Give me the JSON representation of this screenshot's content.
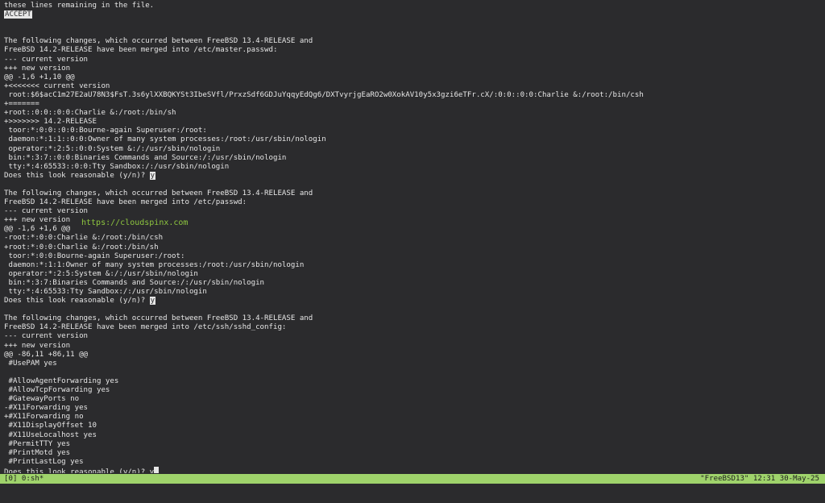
{
  "colors": {
    "background": "#2b2b2d",
    "foreground": "#e6e6e6",
    "statusbar": "#9fd36b",
    "watermark": "#8ec63f"
  },
  "terminal": {
    "lines": [
      {
        "text": "these lines remaining in the file."
      },
      {
        "text": "",
        "highlight": "ACCEPT"
      },
      {
        "text": ""
      },
      {
        "text": ""
      },
      {
        "text": "The following changes, which occurred between FreeBSD 13.4-RELEASE and"
      },
      {
        "text": "FreeBSD 14.2-RELEASE have been merged into /etc/master.passwd:"
      },
      {
        "text": "--- current version"
      },
      {
        "text": "+++ new version"
      },
      {
        "text": "@@ -1,6 +1,10 @@"
      },
      {
        "text": "+<<<<<<< current version"
      },
      {
        "text": " root:$6$acC1m27E2aU78N3$FsT.3s6ylXXBQKYSt3IbeSVfl/PrxzSdf6GDJuYqqyEdQg6/DXTvyrjgEaRO2w0XokAV10y5x3gzi6eTFr.cX/:0:0::0:0:Charlie &:/root:/bin/csh"
      },
      {
        "text": "+======="
      },
      {
        "text": "+root::0:0::0:0:Charlie &:/root:/bin/sh"
      },
      {
        "text": "+>>>>>>> 14.2-RELEASE"
      },
      {
        "text": " toor:*:0:0::0:0:Bourne-again Superuser:/root:"
      },
      {
        "text": " daemon:*:1:1::0:0:Owner of many system processes:/root:/usr/sbin/nologin"
      },
      {
        "text": " operator:*:2:5::0:0:System &:/:/usr/sbin/nologin"
      },
      {
        "text": " bin:*:3:7::0:0:Binaries Commands and Source:/:/usr/sbin/nologin"
      },
      {
        "text": " tty:*:4:65533::0:0:Tty Sandbox:/:/usr/sbin/nologin"
      },
      {
        "text": "Does this look reasonable (y/n)? ",
        "highlight": "y"
      },
      {
        "text": ""
      },
      {
        "text": "The following changes, which occurred between FreeBSD 13.4-RELEASE and"
      },
      {
        "text": "FreeBSD 14.2-RELEASE have been merged into /etc/passwd:"
      },
      {
        "text": "--- current version"
      },
      {
        "text": "+++ new version"
      },
      {
        "text": "@@ -1,6 +1,6 @@"
      },
      {
        "text": "-root:*:0:0:Charlie &:/root:/bin/csh"
      },
      {
        "text": "+root:*:0:0:Charlie &:/root:/bin/sh"
      },
      {
        "text": " toor:*:0:0:Bourne-again Superuser:/root:"
      },
      {
        "text": " daemon:*:1:1:Owner of many system processes:/root:/usr/sbin/nologin"
      },
      {
        "text": " operator:*:2:5:System &:/:/usr/sbin/nologin"
      },
      {
        "text": " bin:*:3:7:Binaries Commands and Source:/:/usr/sbin/nologin"
      },
      {
        "text": " tty:*:4:65533:Tty Sandbox:/:/usr/sbin/nologin"
      },
      {
        "text": "Does this look reasonable (y/n)? ",
        "highlight": "y"
      },
      {
        "text": ""
      },
      {
        "text": "The following changes, which occurred between FreeBSD 13.4-RELEASE and"
      },
      {
        "text": "FreeBSD 14.2-RELEASE have been merged into /etc/ssh/sshd_config:"
      },
      {
        "text": "--- current version"
      },
      {
        "text": "+++ new version"
      },
      {
        "text": "@@ -86,11 +86,11 @@"
      },
      {
        "text": " #UsePAM yes"
      },
      {
        "text": ""
      },
      {
        "text": " #AllowAgentForwarding yes"
      },
      {
        "text": " #AllowTcpForwarding yes"
      },
      {
        "text": " #GatewayPorts no"
      },
      {
        "text": "-#X11Forwarding yes"
      },
      {
        "text": "+#X11Forwarding no"
      },
      {
        "text": " #X11DisplayOffset 10"
      },
      {
        "text": " #X11UseLocalhost yes"
      },
      {
        "text": " #PermitTTY yes"
      },
      {
        "text": " #PrintMotd yes"
      },
      {
        "text": " #PrintLastLog yes"
      },
      {
        "text": "Does this look reasonable (y/n)? y",
        "cursor": true
      }
    ]
  },
  "watermark": {
    "text": "https://cloudspinx.com"
  },
  "statusbar": {
    "left": "[0] 0:sh*",
    "right": "\"FreeBSD13\" 12:31 30-May-25"
  }
}
